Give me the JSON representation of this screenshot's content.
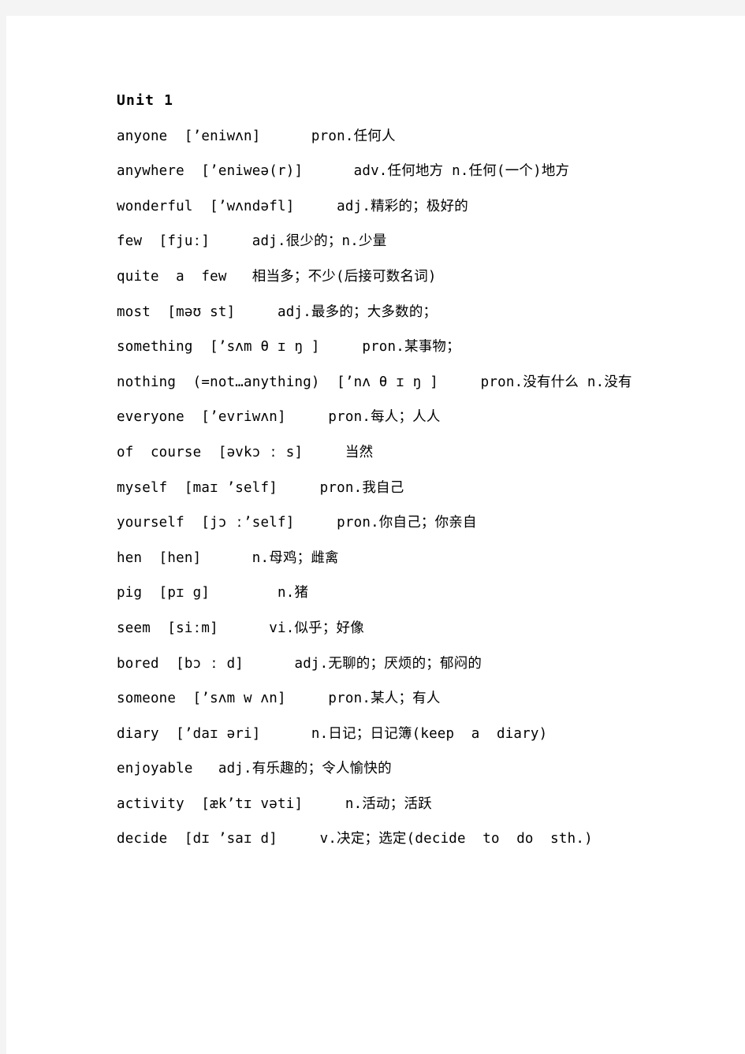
{
  "document": {
    "heading": "Unit 1",
    "entries": [
      {
        "id": "anyone",
        "text": "anyone  [’eniwʌn]      pron.任何人"
      },
      {
        "id": "anywhere",
        "text": "anywhere  [’eniweə(r)]      adv.任何地方 n.任何(一个)地方"
      },
      {
        "id": "wonderful",
        "text": "wonderful  [’wʌndəfl]     adj.精彩的；极好的"
      },
      {
        "id": "few",
        "text": "few  [fjuː]     adj.很少的；n.少量"
      },
      {
        "id": "quite-a-few",
        "text": "quite  a  few   相当多；不少(后接可数名词)"
      },
      {
        "id": "most",
        "text": "most  [məʊ st]     adj.最多的；大多数的；"
      },
      {
        "id": "something",
        "text": "something  [’sʌm θ ɪ ŋ ]     pron.某事物；"
      },
      {
        "id": "nothing",
        "text": "nothing  (=not…anything)  [’nʌ θ ɪ ŋ ]     pron.没有什么 n.没有"
      },
      {
        "id": "everyone",
        "text": "everyone  [’evriwʌn]     pron.每人；人人"
      },
      {
        "id": "of-course",
        "text": "of  course  [əvkɔ ː s]     当然"
      },
      {
        "id": "myself",
        "text": "myself  [maɪ ’self]     pron.我自己"
      },
      {
        "id": "yourself",
        "text": "yourself  [jɔ ː’self]     pron.你自己；你亲自"
      },
      {
        "id": "hen",
        "text": "hen  [hen]      n.母鸡；雌禽"
      },
      {
        "id": "pig",
        "text": "pig  [pɪ g]        n.猪"
      },
      {
        "id": "seem",
        "text": "seem  [siːm]      vi.似乎；好像"
      },
      {
        "id": "bored",
        "text": "bored  [bɔ ː d]      adj.无聊的；厌烦的；郁闷的"
      },
      {
        "id": "someone",
        "text": "someone  [’sʌm w ʌn]     pron.某人；有人"
      },
      {
        "id": "diary",
        "text": "diary  [’daɪ əri]      n.日记；日记簿(keep  a  diary)"
      },
      {
        "id": "enjoyable",
        "text": "enjoyable   adj.有乐趣的；令人愉快的"
      },
      {
        "id": "activity",
        "text": "activity  [æk’tɪ vəti]     n.活动；活跃"
      },
      {
        "id": "decide",
        "text": "decide  [dɪ ’saɪ d]     v.决定；选定(decide  to  do  sth.)"
      }
    ]
  }
}
